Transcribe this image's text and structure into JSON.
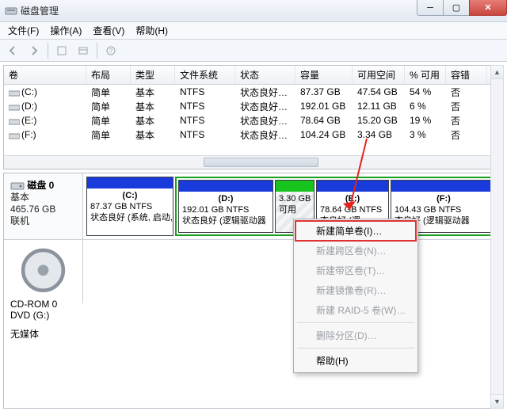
{
  "window": {
    "title": "磁盘管理"
  },
  "menu": {
    "file": "文件(F)",
    "action": "操作(A)",
    "view": "查看(V)",
    "help": "帮助(H)"
  },
  "columns": {
    "volume": "卷",
    "layout": "布局",
    "type": "类型",
    "fs": "文件系统",
    "status": "状态",
    "capacity": "容量",
    "free": "可用空间",
    "pct": "% 可用",
    "fault": "容错"
  },
  "volumes": [
    {
      "name": "(C:)",
      "layout": "简单",
      "type": "基本",
      "fs": "NTFS",
      "status": "状态良好 (…",
      "capacity": "87.37 GB",
      "free": "47.54 GB",
      "pct": "54 %",
      "fault": "否"
    },
    {
      "name": "(D:)",
      "layout": "简单",
      "type": "基本",
      "fs": "NTFS",
      "status": "状态良好 (…",
      "capacity": "192.01 GB",
      "free": "12.11 GB",
      "pct": "6 %",
      "fault": "否"
    },
    {
      "name": "(E:)",
      "layout": "简单",
      "type": "基本",
      "fs": "NTFS",
      "status": "状态良好 (…",
      "capacity": "78.64 GB",
      "free": "15.20 GB",
      "pct": "19 %",
      "fault": "否"
    },
    {
      "name": "(F:)",
      "layout": "简单",
      "type": "基本",
      "fs": "NTFS",
      "status": "状态良好 (…",
      "capacity": "104.24 GB",
      "free": "3.34 GB",
      "pct": "3 %",
      "fault": "否"
    }
  ],
  "disk0": {
    "name": "磁盘 0",
    "type": "基本",
    "size": "465.76 GB",
    "status": "联机",
    "parts": {
      "c": {
        "label": "(C:)",
        "line1": "87.37 GB NTFS",
        "line2": "状态良好 (系统, 启动,"
      },
      "d": {
        "label": "(D:)",
        "line1": "192.01 GB NTFS",
        "line2": "状态良好 (逻辑驱动器"
      },
      "gap": {
        "line1": "3.30 GB",
        "line2": "可用"
      },
      "e": {
        "label": "(E:)",
        "line1": "78.64 GB NTFS",
        "line2": "态良好 (逻"
      },
      "f": {
        "label": "(F:)",
        "line1": "104.43 GB NTFS",
        "line2": "态良好 (逻辑驱动器"
      }
    }
  },
  "cdrom": {
    "name": "CD-ROM 0",
    "sub": "DVD (G:)",
    "status": "无媒体"
  },
  "context_menu": {
    "new_simple": "新建简单卷(I)…",
    "new_span": "新建跨区卷(N)…",
    "new_stripe": "新建带区卷(T)…",
    "new_mirror": "新建镜像卷(R)…",
    "new_raid5": "新建 RAID-5 卷(W)…",
    "delete": "删除分区(D)…",
    "help": "帮助(H)"
  }
}
